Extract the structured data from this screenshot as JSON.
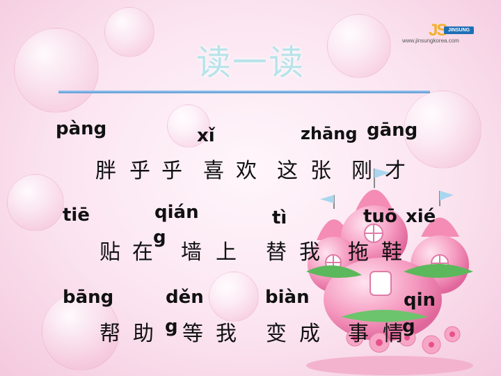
{
  "logo": {
    "mark": "JS",
    "badge": "JINSUNG",
    "url": "www.jinsungkorea.com"
  },
  "title": "读一读",
  "rows": [
    {
      "pinyin": [
        "pàng",
        "xǐ",
        "zhāng",
        "gāng"
      ],
      "hanzi": [
        "胖",
        "乎",
        "乎",
        "喜",
        "欢",
        "这",
        "张",
        "刚",
        "才"
      ]
    },
    {
      "pinyin": [
        "tiē",
        "qián",
        "g",
        "tì",
        "tuō",
        "xié"
      ],
      "hanzi": [
        "贴",
        "在",
        "墙",
        "上",
        "替",
        "我",
        "拖",
        "鞋"
      ]
    },
    {
      "pinyin": [
        "bāng",
        "děn",
        "g",
        "biàn",
        "qin",
        "g"
      ],
      "hanzi": [
        "帮",
        "助",
        "等",
        "我",
        "变",
        "成",
        "事",
        "情"
      ]
    }
  ],
  "colors": {
    "title": "#b8e3ea",
    "rule": "#5b97d6",
    "text": "#111111",
    "background": "#fbe4f0"
  }
}
